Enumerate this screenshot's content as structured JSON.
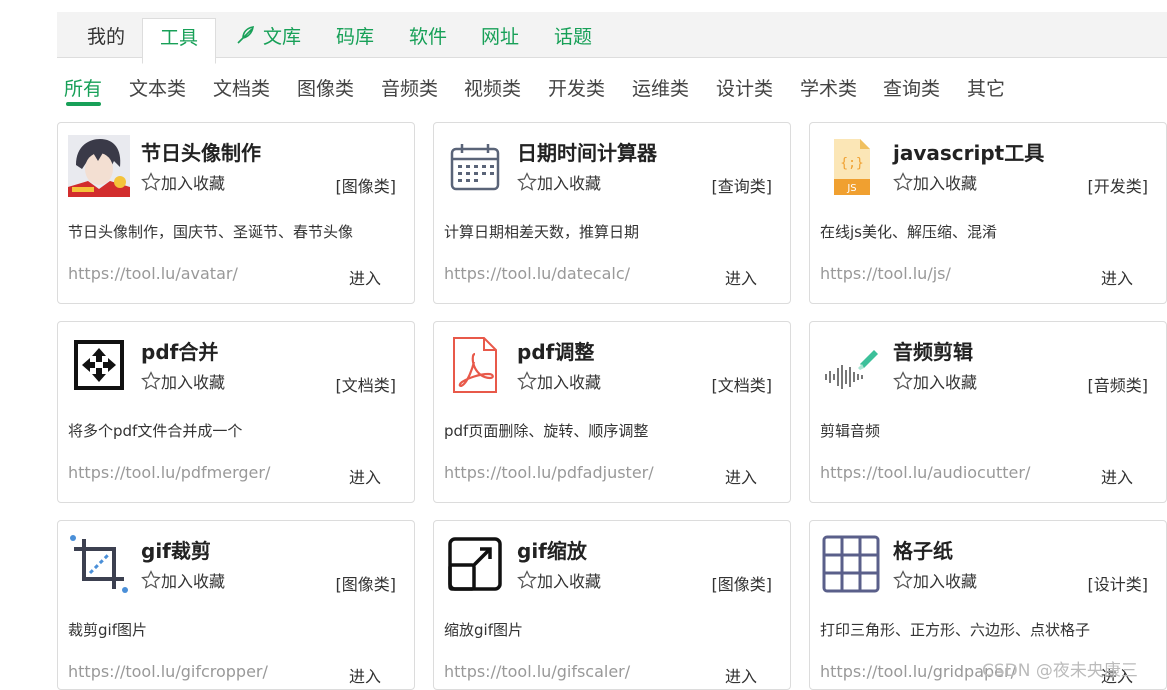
{
  "top_tabs": {
    "mine": "我的",
    "tools": "工具",
    "docs": "文库",
    "code": "码库",
    "software": "软件",
    "urls": "网址",
    "topics": "话题"
  },
  "categories": [
    "所有",
    "文本类",
    "文档类",
    "图像类",
    "音频类",
    "视频类",
    "开发类",
    "运维类",
    "设计类",
    "学术类",
    "查询类",
    "其它"
  ],
  "fav_label": "加入收藏",
  "enter_label": "进入",
  "cards": [
    {
      "title": "节日头像制作",
      "tag": "[图像类]",
      "desc": "节日头像制作，国庆节、圣诞节、春节头像",
      "url": "https://tool.lu/avatar/",
      "icon": "avatar-image-icon"
    },
    {
      "title": "日期时间计算器",
      "tag": "[查询类]",
      "desc": "计算日期相差天数，推算日期",
      "url": "https://tool.lu/datecalc/",
      "icon": "calendar-icon"
    },
    {
      "title": "javascript工具",
      "tag": "[开发类]",
      "desc": "在线js美化、解压缩、混淆",
      "url": "https://tool.lu/js/",
      "icon": "js-file-icon"
    },
    {
      "title": "pdf合并",
      "tag": "[文档类]",
      "desc": "将多个pdf文件合并成一个",
      "url": "https://tool.lu/pdfmerger/",
      "icon": "merge-icon"
    },
    {
      "title": "pdf调整",
      "tag": "[文档类]",
      "desc": "pdf页面删除、旋转、顺序调整",
      "url": "https://tool.lu/pdfadjuster/",
      "icon": "pdf-file-icon"
    },
    {
      "title": "音频剪辑",
      "tag": "[音频类]",
      "desc": "剪辑音频",
      "url": "https://tool.lu/audiocutter/",
      "icon": "audio-wave-icon"
    },
    {
      "title": "gif裁剪",
      "tag": "[图像类]",
      "desc": "裁剪gif图片",
      "url": "https://tool.lu/gifcropper/",
      "icon": "crop-icon"
    },
    {
      "title": "gif缩放",
      "tag": "[图像类]",
      "desc": "缩放gif图片",
      "url": "https://tool.lu/gifscaler/",
      "icon": "resize-icon"
    },
    {
      "title": "格子纸",
      "tag": "[设计类]",
      "desc": "打印三角形、正方形、六边形、点状格子",
      "url": "https://tool.lu/gridpaper/",
      "icon": "grid-icon"
    }
  ],
  "watermark": "CSDN @夜未央康三",
  "colors": {
    "accent": "#18a058",
    "js_orange": "#f0a030",
    "pdf_red": "#e8594a",
    "audio_green": "#3cc09a",
    "grid_purple": "#5a5f8a"
  }
}
